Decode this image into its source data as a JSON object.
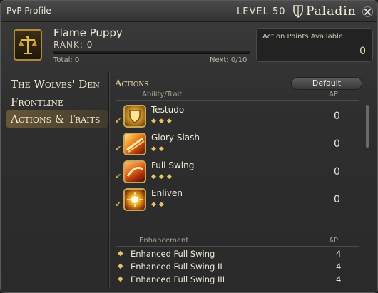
{
  "window": {
    "title": "PvP Profile",
    "level_label": "LEVEL 50",
    "job_icon": "paladin-shield-icon",
    "job_name": "Paladin",
    "close_icon": "close-x-icon"
  },
  "profile": {
    "emblem_icon": "scales-emblem-icon",
    "name": "Flame Puppy",
    "rank_label": "RANK: 0",
    "rank_progress": 0,
    "total_label": "Total: 0",
    "next_label": "Next: 0/10",
    "ap_label": "Action Points Available",
    "ap_value": "0"
  },
  "sidebar": {
    "items": [
      {
        "label": "The Wolves' Den",
        "active": false
      },
      {
        "label": "Frontline",
        "active": false
      },
      {
        "label": "Actions & Traits",
        "active": true
      }
    ]
  },
  "actions": {
    "title": "Actions",
    "default_button": "Default",
    "col_ability": "Ability/Trait",
    "col_ap": "AP",
    "rows": [
      {
        "name": "Testudo",
        "diamonds": "◆◆◆",
        "ap": "0",
        "icon": "testudo-shield-icon"
      },
      {
        "name": "Glory Slash",
        "diamonds": "◆◆",
        "ap": "0",
        "icon": "glory-slash-icon"
      },
      {
        "name": "Full Swing",
        "diamonds": "◆◆◆",
        "ap": "0",
        "icon": "full-swing-icon"
      },
      {
        "name": "Enliven",
        "diamonds": "◆◆",
        "ap": "0",
        "icon": "enliven-icon"
      }
    ]
  },
  "enhancement": {
    "col_name": "Enhancement",
    "col_ap": "AP",
    "rows": [
      {
        "name": "Enhanced Full Swing",
        "ap": "4"
      },
      {
        "name": "Enhanced Full Swing II",
        "ap": "4"
      },
      {
        "name": "Enhanced Full Swing III",
        "ap": "4"
      }
    ]
  },
  "colors": {
    "accent_gold": "#e4c46a",
    "panel_bg": "#2e2e2e",
    "active_highlight": "#967c3c"
  }
}
